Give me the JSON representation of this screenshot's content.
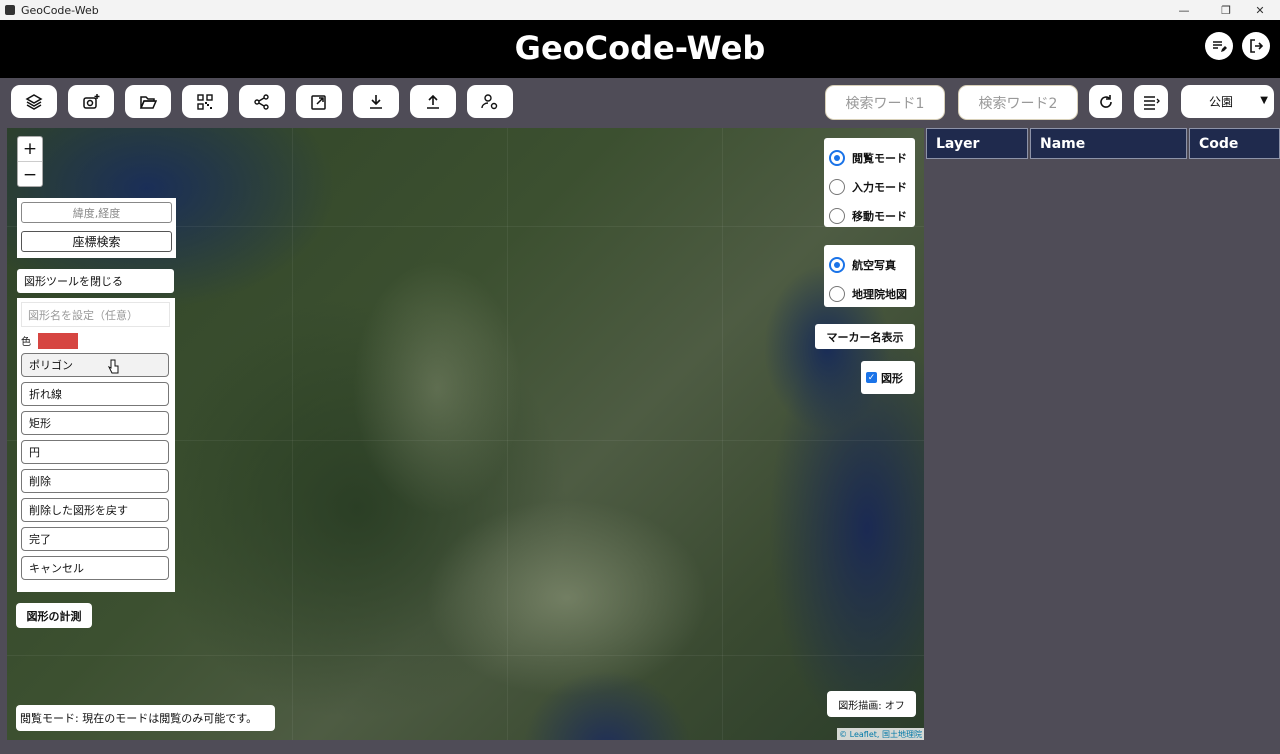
{
  "window": {
    "title": "GeoCode-Web",
    "controls": [
      "—",
      "❐",
      "✕"
    ]
  },
  "header": {
    "title": "GeoCode-Web",
    "right_icons": [
      "edit-list-icon",
      "logout-icon"
    ]
  },
  "toolbar": {
    "icons": [
      "layers-icon",
      "camera-add-icon",
      "folder-open-icon",
      "qr-code-icon",
      "share-icon",
      "external-link-icon",
      "download-icon",
      "upload-icon",
      "user-settings-icon"
    ],
    "search1_placeholder": "検索ワード1",
    "search2_placeholder": "検索ワード2",
    "right_icons": [
      "refresh-icon",
      "list-icon"
    ],
    "category_select": "公園"
  },
  "map": {
    "zoom_in": "+",
    "zoom_out": "−",
    "coord_placeholder": "緯度,経度",
    "coord_search": "座標検索",
    "close_shape_tools": "図形ツールを閉じる",
    "shape_name_placeholder": "図形名を設定（任意）",
    "color_label": "色",
    "color_value": "#d64541",
    "shape_buttons": [
      "ポリゴン",
      "折れ線",
      "矩形",
      "円",
      "削除",
      "削除した図形を戻す",
      "完了",
      "キャンセル"
    ],
    "measure_button": "図形の計測",
    "modes": [
      "閲覧モード",
      "入力モード",
      "移動モード"
    ],
    "selected_mode": "閲覧モード",
    "basemaps": [
      "航空写真",
      "地理院地図"
    ],
    "selected_basemap": "航空写真",
    "marker_name_button": "マーカー名表示",
    "shape_checkbox_label": "図形",
    "shape_checkbox_checked": true,
    "status_message": "閲覧モード: 現在のモードは閲覧のみ可能です。",
    "draw_status": "図形描画: オフ",
    "attribution": "© Leaflet, 国土地理院"
  },
  "table": {
    "columns": [
      "Layer",
      "Name",
      "Code"
    ],
    "rows": []
  }
}
